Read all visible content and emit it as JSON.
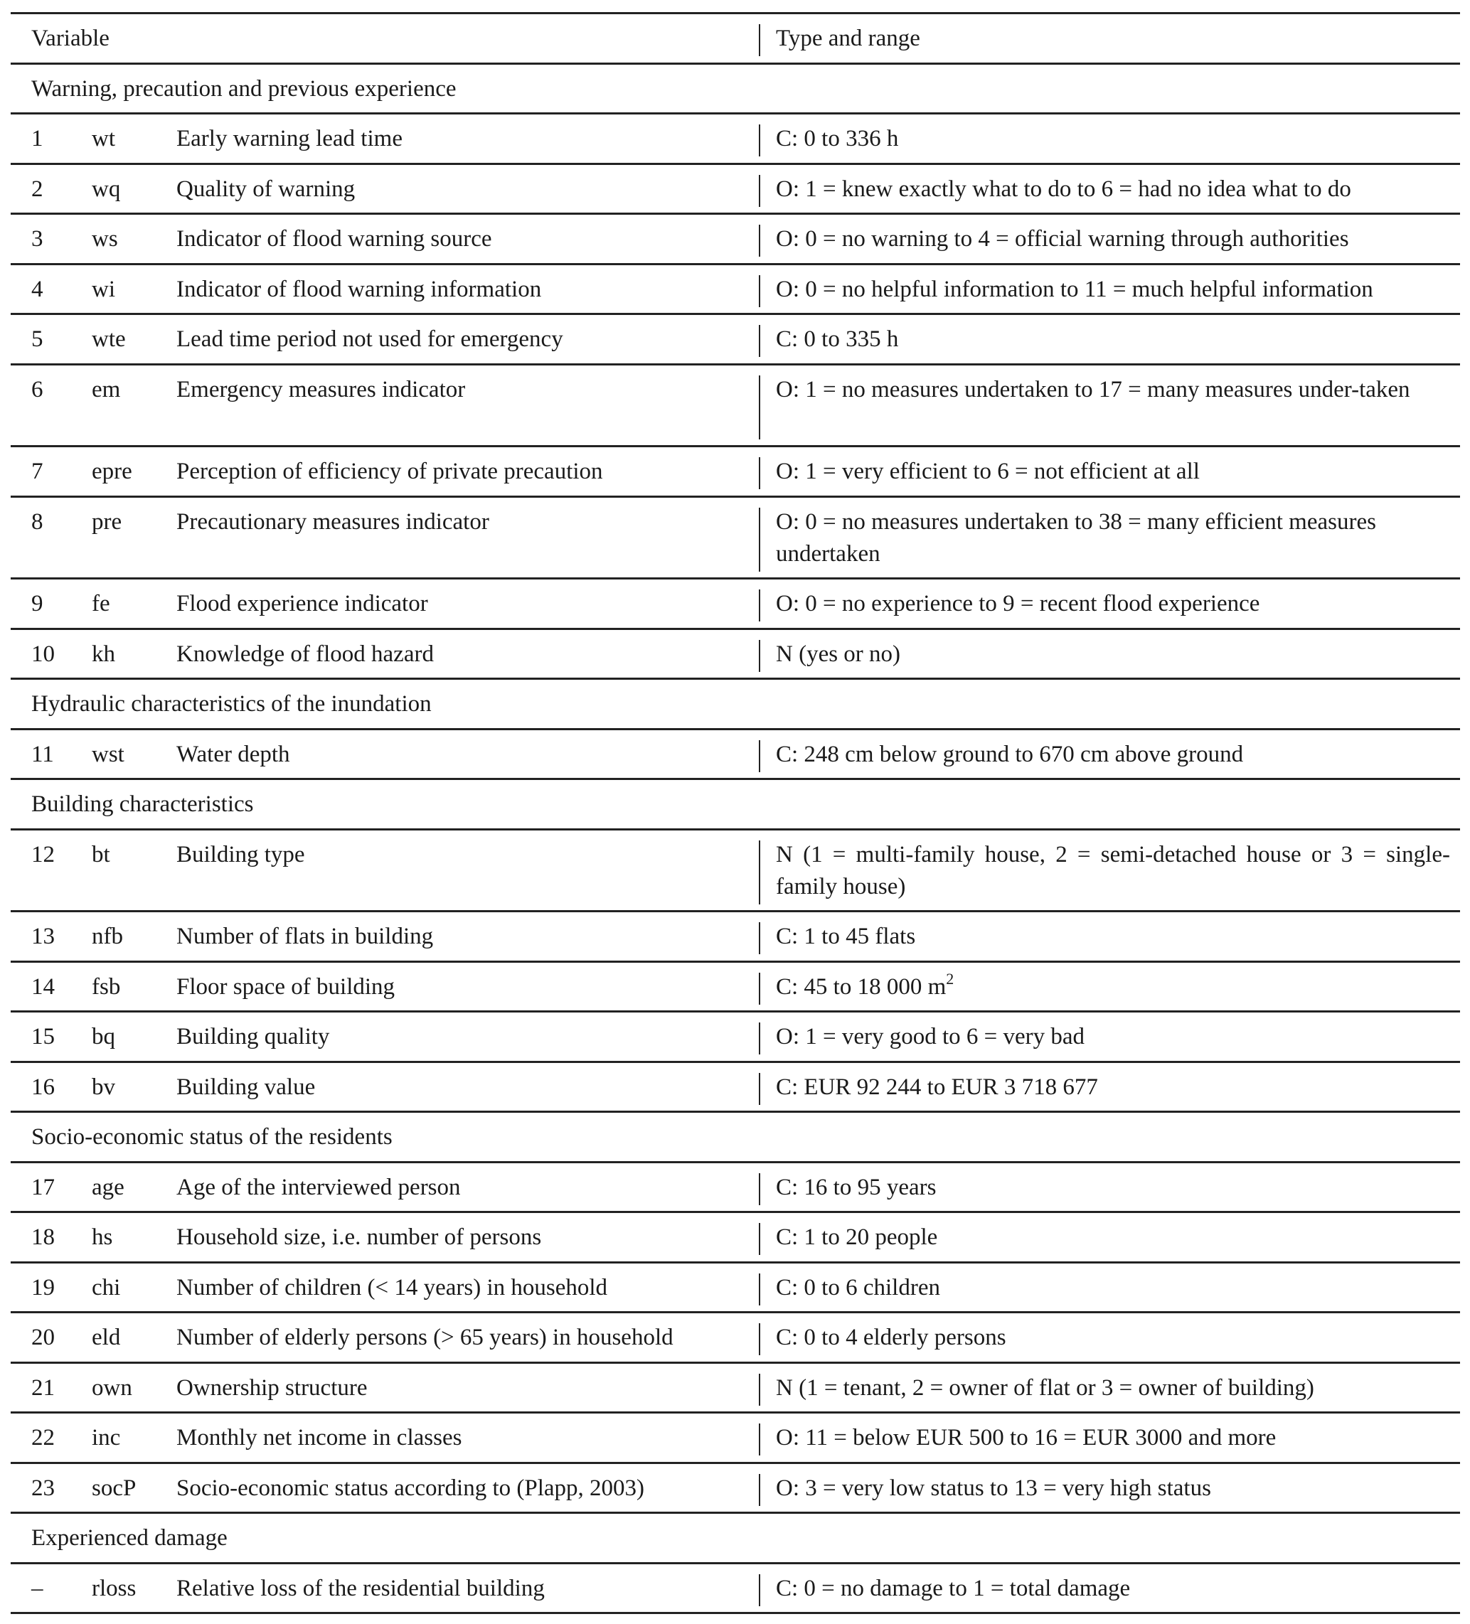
{
  "header": {
    "variable": "Variable",
    "type_and_range": "Type and range"
  },
  "sections": [
    {
      "title": "Warning, precaution and previous experience",
      "rows": [
        {
          "num": "1",
          "abbr": "wt",
          "desc": "Early warning lead time",
          "type": "C: 0 to 336 h"
        },
        {
          "num": "2",
          "abbr": "wq",
          "desc": "Quality of warning",
          "type": "O: 1 = knew exactly what to do to 6 = had no idea what to do"
        },
        {
          "num": "3",
          "abbr": "ws",
          "desc": "Indicator of flood warning source",
          "type": "O: 0 = no warning to 4 = official warning through authorities"
        },
        {
          "num": "4",
          "abbr": "wi",
          "desc": "Indicator of flood warning information",
          "type": "O: 0 = no helpful information to 11 = much helpful information"
        },
        {
          "num": "5",
          "abbr": "wte",
          "desc": "Lead time period not used for emergency",
          "type": "C: 0 to 335 h"
        },
        {
          "num": "6",
          "abbr": "em",
          "desc": "Emergency measures indicator",
          "type": "O: 1 = no measures undertaken to 17 = many measures under-taken",
          "lines": 2
        },
        {
          "num": "7",
          "abbr": "epre",
          "desc": "Perception of efficiency of private precaution",
          "type": "O: 1 = very efficient to 6 = not efficient at all"
        },
        {
          "num": "8",
          "abbr": "pre",
          "desc": "Precautionary measures indicator",
          "type": "O: 0 = no measures undertaken to 38 = many efficient measures undertaken",
          "lines": 2
        },
        {
          "num": "9",
          "abbr": "fe",
          "desc": "Flood experience indicator",
          "type": "O: 0 = no experience to 9 = recent flood experience"
        },
        {
          "num": "10",
          "abbr": "kh",
          "desc": "Knowledge of flood hazard",
          "type": "N (yes or no)"
        }
      ]
    },
    {
      "title": "Hydraulic characteristics of the inundation",
      "rows": [
        {
          "num": "11",
          "abbr": "wst",
          "desc": "Water depth",
          "type": "C: 248 cm below ground to 670 cm above ground"
        }
      ]
    },
    {
      "title": "Building characteristics",
      "rows": [
        {
          "num": "12",
          "abbr": "bt",
          "desc": "Building type",
          "type": "N (1 = multi-family house, 2 = semi-detached house or 3 = single-family house)",
          "lines": 2,
          "justify": true
        },
        {
          "num": "13",
          "abbr": "nfb",
          "desc": "Number of flats in building",
          "type": "C: 1 to 45 flats"
        },
        {
          "num": "14",
          "abbr": "fsb",
          "desc": "Floor space of building",
          "type": "C: 45 to 18 000 m",
          "type_sup": "2"
        },
        {
          "num": "15",
          "abbr": "bq",
          "desc": "Building quality",
          "type": "O: 1 = very good to 6 = very bad"
        },
        {
          "num": "16",
          "abbr": "bv",
          "desc": "Building value",
          "type": "C: EUR 92 244 to EUR 3 718 677"
        }
      ]
    },
    {
      "title": "Socio-economic status of the residents",
      "rows": [
        {
          "num": "17",
          "abbr": "age",
          "desc": "Age of the interviewed person",
          "type": "C: 16 to 95 years"
        },
        {
          "num": "18",
          "abbr": "hs",
          "desc": "Household size, i.e. number of persons",
          "type": "C: 1 to 20 people"
        },
        {
          "num": "19",
          "abbr": "chi",
          "desc": "Number of children (< 14 years) in household",
          "type": "C: 0 to 6 children"
        },
        {
          "num": "20",
          "abbr": "eld",
          "desc": "Number of elderly persons (> 65 years) in household",
          "type": "C: 0 to 4 elderly persons"
        },
        {
          "num": "21",
          "abbr": "own",
          "desc": "Ownership structure",
          "type": "N (1 = tenant, 2 = owner of flat or 3 = owner of building)"
        },
        {
          "num": "22",
          "abbr": "inc",
          "desc": "Monthly net income in classes",
          "type": "O: 11 = below EUR 500 to 16 = EUR 3000 and more"
        },
        {
          "num": "23",
          "abbr": "socP",
          "desc": "Socio-economic status according to (Plapp, 2003)",
          "type": "O: 3 = very low status to 13 = very high status"
        }
      ]
    },
    {
      "title": "Experienced damage",
      "rows": [
        {
          "num": "–",
          "abbr": "rloss",
          "desc": "Relative loss of the residential building",
          "type": "C: 0 = no damage to 1 = total damage"
        }
      ]
    }
  ]
}
